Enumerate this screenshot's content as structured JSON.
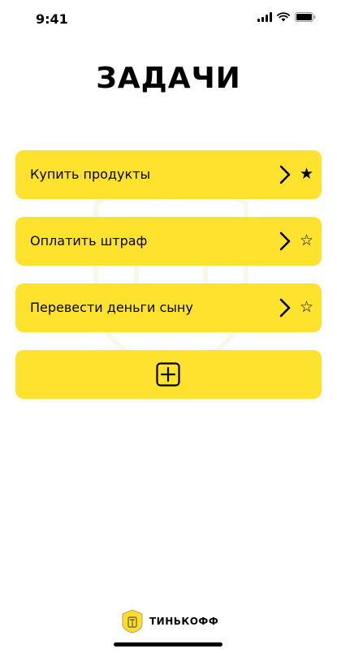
{
  "status_bar": {
    "time": "9:41"
  },
  "page": {
    "title": "ЗАДАЧИ"
  },
  "tasks": [
    {
      "label": "Купить продукты",
      "star": "★",
      "starred": true
    },
    {
      "label": "Оплатить штраф",
      "star": "☆",
      "starred": false
    },
    {
      "label": "Перевести деньги сыну",
      "star": "☆",
      "starred": false
    }
  ],
  "add_button": {
    "icon": "plus-square-icon"
  },
  "footer": {
    "brand": "ТИНЬКОФФ"
  },
  "colors": {
    "accent": "#FFE22E",
    "text": "#000000",
    "background": "#FFFFFF"
  }
}
